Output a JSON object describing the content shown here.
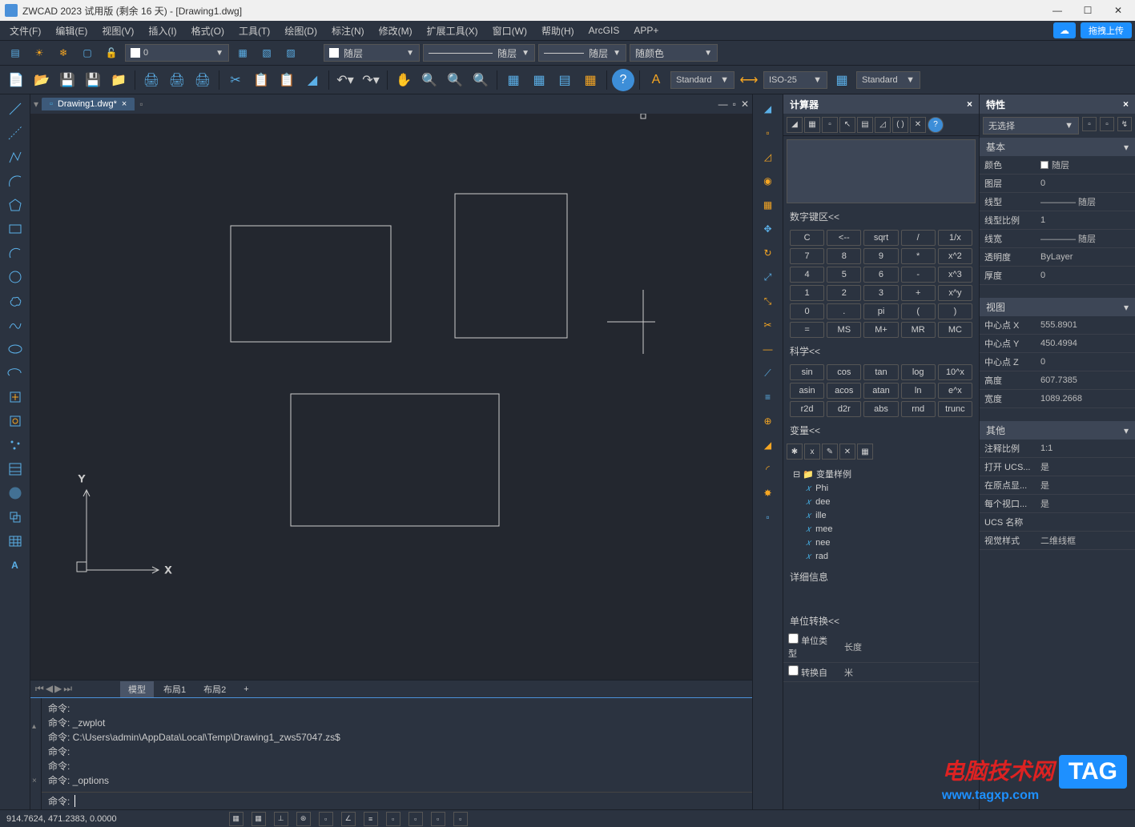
{
  "titlebar": {
    "title": "ZWCAD 2023 试用版 (剩余 16 天) - [Drawing1.dwg]"
  },
  "menu": [
    "文件(F)",
    "编辑(E)",
    "视图(V)",
    "插入(I)",
    "格式(O)",
    "工具(T)",
    "绘图(D)",
    "标注(N)",
    "修改(M)",
    "扩展工具(X)",
    "窗口(W)",
    "帮助(H)",
    "ArcGIS",
    "APP+"
  ],
  "upload_label": "拖拽上传",
  "layer": {
    "current": "0",
    "linetype": "随层",
    "linetype2": "随层",
    "linetype3": "随层",
    "color": "随颜色"
  },
  "textstyle": "Standard",
  "dimstyle": "ISO-25",
  "tablestyle": "Standard",
  "tab": {
    "name": "Drawing1.dwg*"
  },
  "bottomtabs": [
    "模型",
    "布局1",
    "布局2",
    "+"
  ],
  "cmd": {
    "lines": [
      "命令:",
      "命令: _zwplot",
      "命令: C:\\Users\\admin\\AppData\\Local\\Temp\\Drawing1_zws57047.zs$",
      "命令:",
      "命令:",
      "命令: _options"
    ],
    "prompt": "命令:"
  },
  "calculator": {
    "title": "计算器",
    "numpad_head": "数字键区<<",
    "keys": [
      "C",
      "<--",
      "sqrt",
      "/",
      "1/x",
      "7",
      "8",
      "9",
      "*",
      "x^2",
      "4",
      "5",
      "6",
      "-",
      "x^3",
      "1",
      "2",
      "3",
      "+",
      "x^y",
      "0",
      ".",
      "pi",
      "(",
      ")",
      "=",
      "MS",
      "M+",
      "MR",
      "MC"
    ],
    "sci_head": "科学<<",
    "sci_keys": [
      "sin",
      "cos",
      "tan",
      "log",
      "10^x",
      "asin",
      "acos",
      "atan",
      "ln",
      "e^x",
      "r2d",
      "d2r",
      "abs",
      "rnd",
      "trunc"
    ],
    "var_head": "变量<<",
    "var_folder": "变量样例",
    "vars": [
      "Phi",
      "dee",
      "ille",
      "mee",
      "nee",
      "rad"
    ],
    "detail_head": "详细信息",
    "unit_head": "单位转换<<",
    "unit_type_label": "单位类型",
    "unit_type_val": "长度",
    "unit_from_label": "转换自",
    "unit_from_val": "米"
  },
  "properties": {
    "title": "特性",
    "selection": "无选择",
    "groups": {
      "basic": {
        "head": "基本",
        "rows": [
          {
            "label": "颜色",
            "value": "随层",
            "swatch": true
          },
          {
            "label": "图层",
            "value": "0"
          },
          {
            "label": "线型",
            "value": "———— 随层"
          },
          {
            "label": "线型比例",
            "value": "1"
          },
          {
            "label": "线宽",
            "value": "———— 随层"
          },
          {
            "label": "透明度",
            "value": "ByLayer"
          },
          {
            "label": "厚度",
            "value": "0"
          }
        ]
      },
      "view": {
        "head": "视图",
        "rows": [
          {
            "label": "中心点 X",
            "value": "555.8901"
          },
          {
            "label": "中心点 Y",
            "value": "450.4994"
          },
          {
            "label": "中心点 Z",
            "value": "0"
          },
          {
            "label": "高度",
            "value": "607.7385"
          },
          {
            "label": "宽度",
            "value": "1089.2668"
          }
        ]
      },
      "other": {
        "head": "其他",
        "rows": [
          {
            "label": "注释比例",
            "value": "1:1"
          },
          {
            "label": "打开 UCS...",
            "value": "是"
          },
          {
            "label": "在原点显...",
            "value": "是"
          },
          {
            "label": "每个视口...",
            "value": "是"
          },
          {
            "label": "UCS 名称",
            "value": ""
          },
          {
            "label": "视觉样式",
            "value": "二维线框"
          }
        ]
      }
    }
  },
  "status": {
    "coords": "914.7624, 471.2383, 0.0000"
  },
  "watermark": {
    "text1": "电脑技术网",
    "tag": "TAG",
    "url": "www.tagxp.com"
  }
}
